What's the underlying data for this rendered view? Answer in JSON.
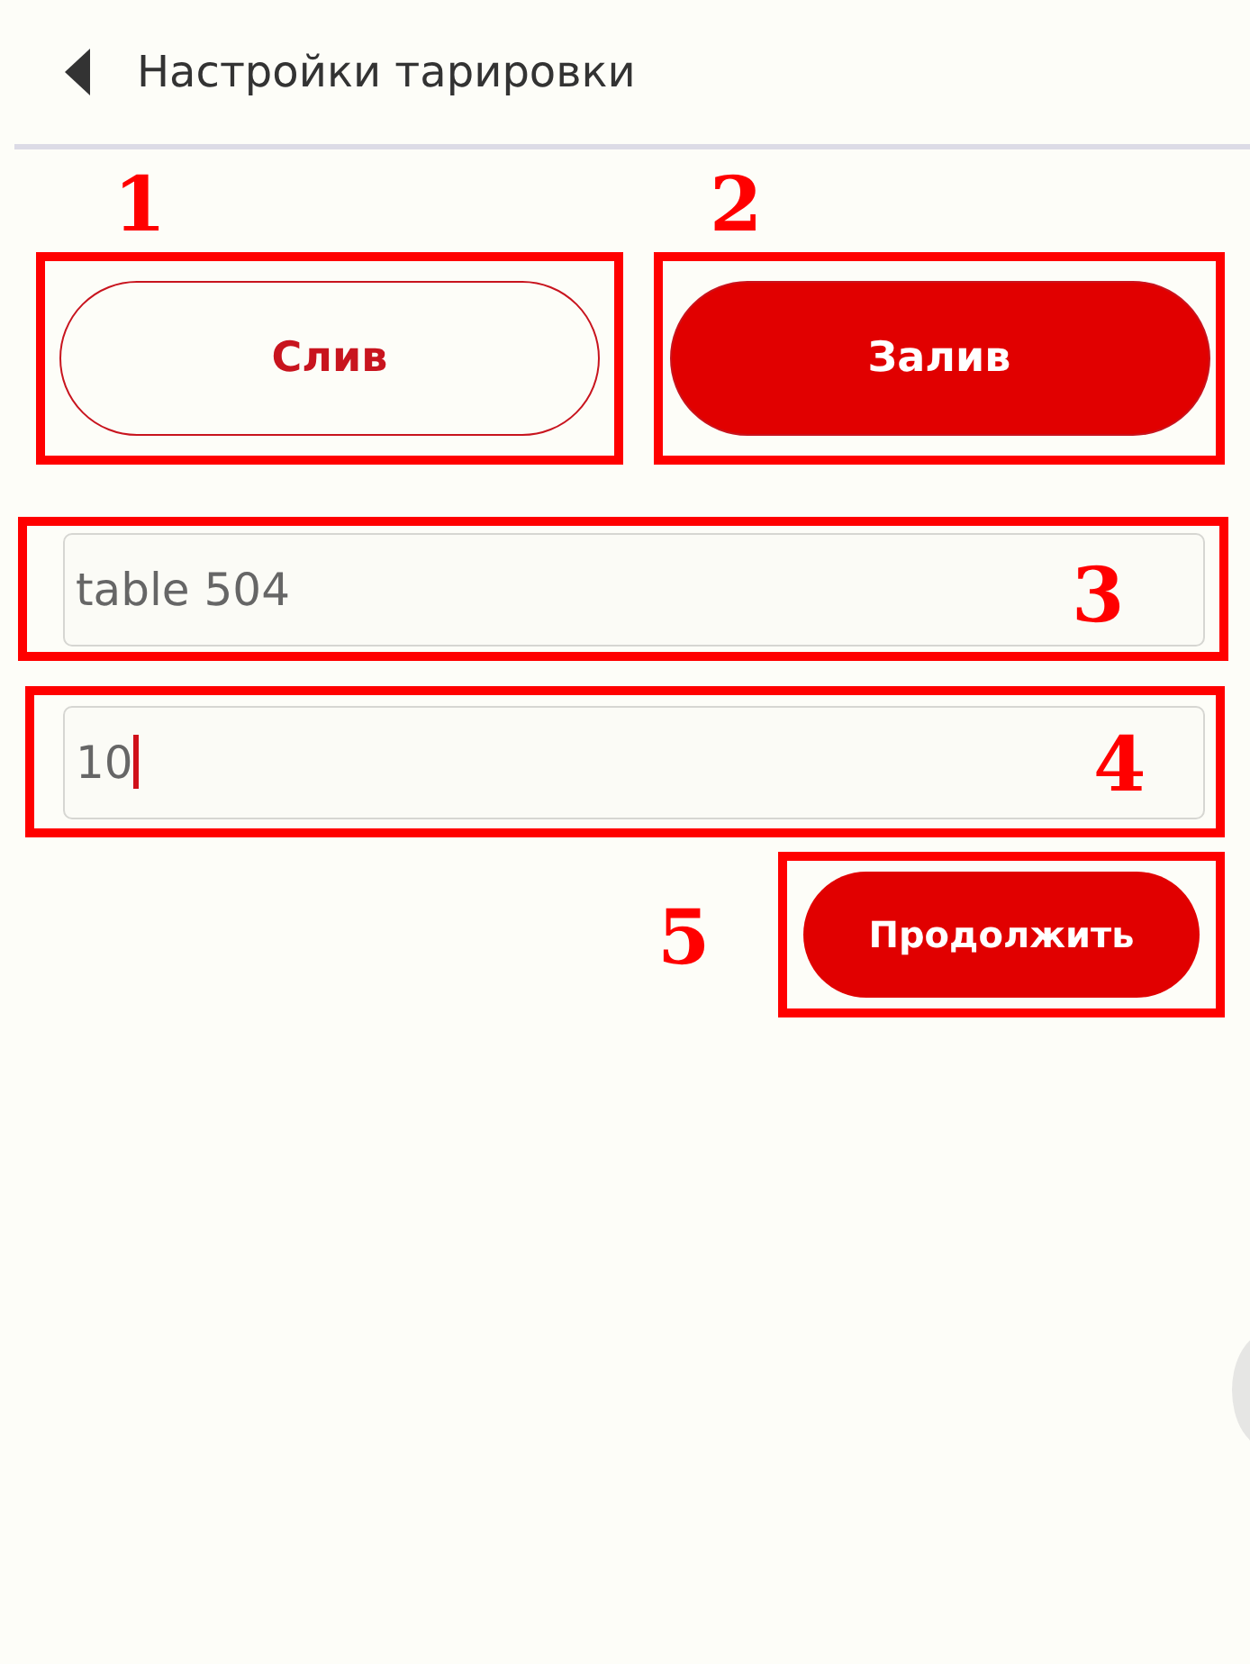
{
  "header": {
    "title": "Настройки тарировки"
  },
  "mode_buttons": [
    {
      "label": "Слив",
      "selected": false,
      "marker": "1"
    },
    {
      "label": "Залив",
      "selected": true,
      "marker": "2"
    }
  ],
  "fields": [
    {
      "value": "table 504",
      "focused": false,
      "marker": "3"
    },
    {
      "value": "10",
      "focused": true,
      "marker": "4"
    }
  ],
  "continue_button": {
    "label": "Продолжить",
    "marker": "5"
  }
}
